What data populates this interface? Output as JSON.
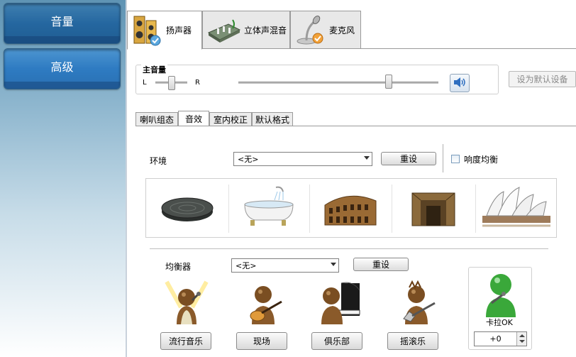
{
  "sidebar": {
    "items": [
      {
        "label": "音量"
      },
      {
        "label": "高级"
      }
    ]
  },
  "tabs": [
    {
      "label": "扬声器",
      "icon": "speaker-icon",
      "active": true
    },
    {
      "label": "立体声混音",
      "icon": "mixer-board-icon",
      "active": false
    },
    {
      "label": "麦克风",
      "icon": "microphone-icon",
      "active": false
    }
  ],
  "master_volume": {
    "label": "主音量",
    "left_label": "L",
    "right_label": "R",
    "balance_level": 0.5,
    "volume_level": 0.75,
    "mute_icon": "volume-speaker-icon",
    "set_default_label": "设为默认设备"
  },
  "sub_tabs": [
    {
      "label": "喇叭组态",
      "active": false
    },
    {
      "label": "音效",
      "active": true
    },
    {
      "label": "室内校正",
      "active": false
    },
    {
      "label": "默认格式",
      "active": false
    }
  ],
  "environment": {
    "label": "环境",
    "selected": "<无>",
    "reset_label": "重设",
    "loudness_label": "响度均衡",
    "loudness_checked": false,
    "presets": [
      {
        "icon": "sewer-manhole-icon"
      },
      {
        "icon": "bathtub-icon"
      },
      {
        "icon": "colosseum-icon"
      },
      {
        "icon": "stone-corridor-icon"
      },
      {
        "icon": "opera-house-icon"
      }
    ]
  },
  "equalizer": {
    "label": "均衡器",
    "selected": "<无>",
    "reset_label": "重设",
    "presets": [
      {
        "label": "流行音乐",
        "icon": "pop-singer-icon"
      },
      {
        "label": "现场",
        "icon": "live-guitarist-icon"
      },
      {
        "label": "俱乐部",
        "icon": "club-pianist-icon"
      },
      {
        "label": "摇滚乐",
        "icon": "rock-guitarist-icon"
      }
    ]
  },
  "karaoke": {
    "label": "卡拉OK",
    "value": "+0",
    "icon": "karaoke-singer-icon"
  },
  "colors": {
    "sidebar_button": "#2567a0",
    "sidebar_button_active": "#2e7bc2",
    "panel_border": "#9a9a9a",
    "karaoke_green": "#3aa83a"
  }
}
